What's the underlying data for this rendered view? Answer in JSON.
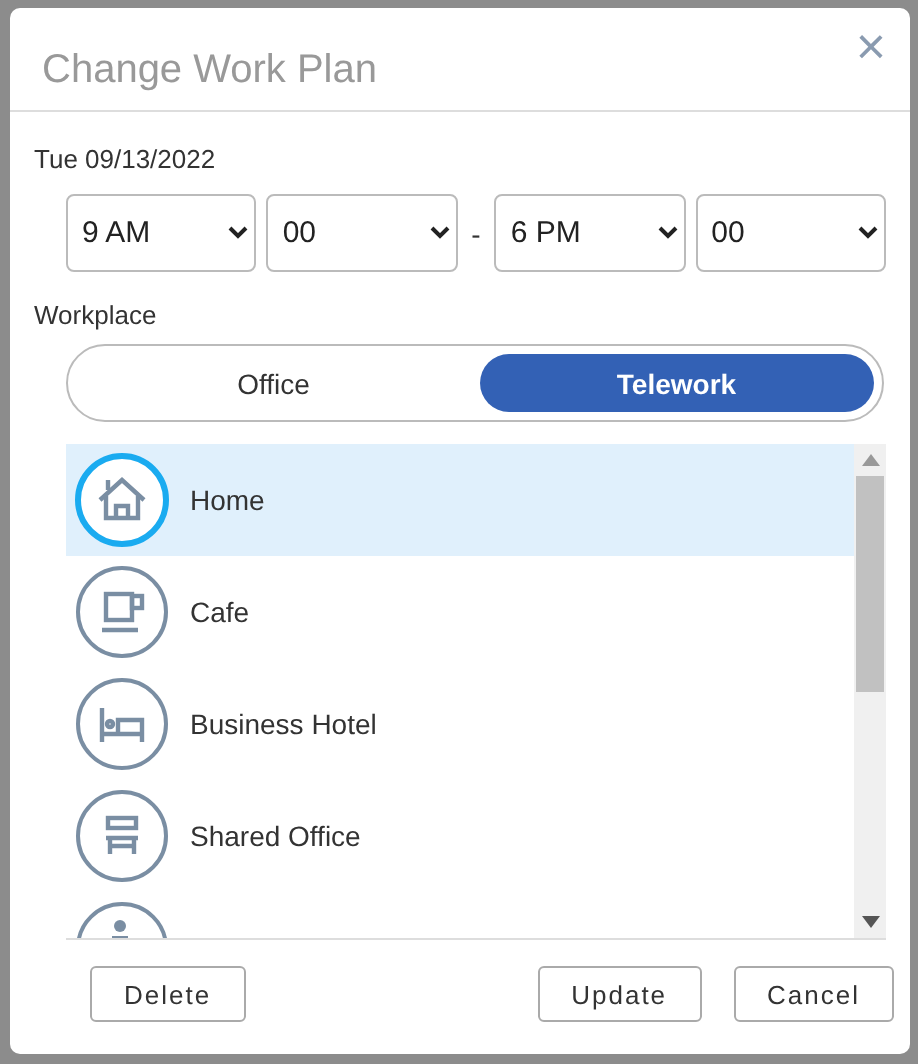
{
  "dialog": {
    "title": "Change Work Plan",
    "close": "×"
  },
  "date": "Tue 09/13/2022",
  "time": {
    "start_hour": "9 AM",
    "start_minute": "00",
    "separator": "-",
    "end_hour": "6 PM",
    "end_minute": "00"
  },
  "workplace": {
    "label": "Workplace",
    "modes": [
      {
        "label": "Office",
        "selected": false
      },
      {
        "label": "Telework",
        "selected": true
      }
    ],
    "places": [
      {
        "label": "Home",
        "kind": "home",
        "selected": true
      },
      {
        "label": "Cafe",
        "kind": "cafe",
        "selected": false
      },
      {
        "label": "Business Hotel",
        "kind": "hotel",
        "selected": false
      },
      {
        "label": "Shared Office",
        "kind": "shared",
        "selected": false
      },
      {
        "kind": "rental",
        "selected": false
      }
    ]
  },
  "buttons": {
    "delete": "Delete",
    "update": "Update",
    "cancel": "Cancel"
  }
}
